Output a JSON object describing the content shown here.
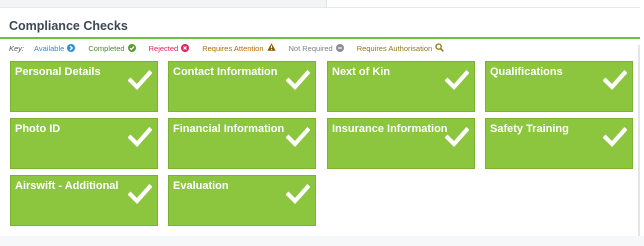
{
  "section": {
    "title": "Compliance Checks"
  },
  "legend": {
    "key_label": "Key:",
    "items": [
      {
        "label": "Available",
        "color": "#2e8fd6",
        "icon": "chevron-right-circle-icon"
      },
      {
        "label": "Completed",
        "color": "#5a9e2f",
        "icon": "check-circle-icon"
      },
      {
        "label": "Rejected",
        "color": "#e0245e",
        "icon": "x-circle-icon"
      },
      {
        "label": "Requires Attention",
        "color": "#c47a00",
        "icon": "warning-triangle-icon"
      },
      {
        "label": "Not Required",
        "color": "#8a8f96",
        "icon": "minus-circle-icon"
      },
      {
        "label": "Requires Authorisation",
        "color": "#8f7a1a",
        "icon": "magnifier-icon"
      }
    ]
  },
  "colors": {
    "tile_bg": "#8cc63f",
    "accent_rule": "#6fbf3f",
    "title_text": "#3e4756"
  },
  "tiles": [
    {
      "label": "Personal Details",
      "status": "Completed",
      "icon": "checkmark-icon"
    },
    {
      "label": "Contact Information",
      "status": "Completed",
      "icon": "checkmark-icon"
    },
    {
      "label": "Next of Kin",
      "status": "Completed",
      "icon": "checkmark-icon"
    },
    {
      "label": "Qualifications",
      "status": "Completed",
      "icon": "checkmark-icon"
    },
    {
      "label": "Photo ID",
      "status": "Completed",
      "icon": "checkmark-icon"
    },
    {
      "label": "Financial Information",
      "status": "Completed",
      "icon": "checkmark-icon"
    },
    {
      "label": "Insurance Information",
      "status": "Completed",
      "icon": "checkmark-icon"
    },
    {
      "label": "Safety Training",
      "status": "Completed",
      "icon": "checkmark-icon"
    },
    {
      "label": "Airswift - Additional",
      "status": "Completed",
      "icon": "checkmark-icon"
    },
    {
      "label": "Evaluation",
      "status": "Completed",
      "icon": "checkmark-icon"
    }
  ]
}
